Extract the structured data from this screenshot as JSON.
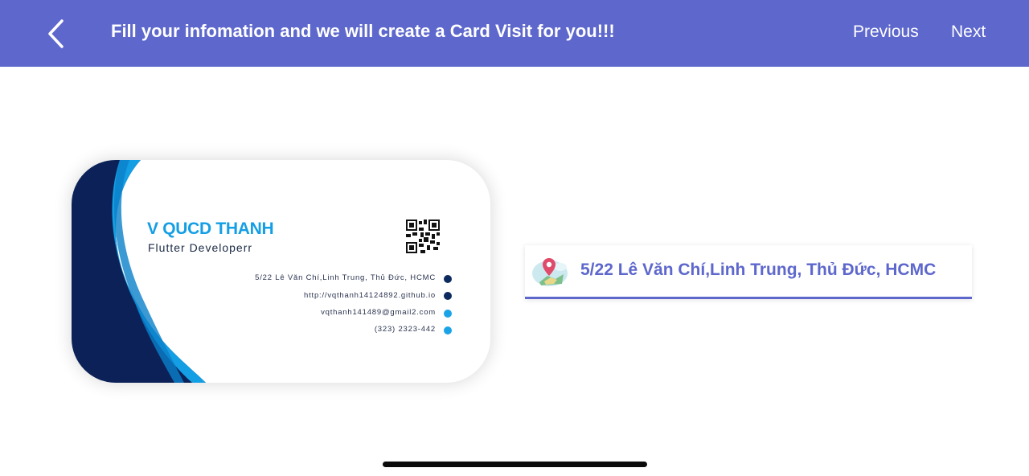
{
  "header": {
    "title": "Fill your infomation and we will create a Card Visit for you!!!",
    "previous_label": "Previous",
    "next_label": "Next"
  },
  "card": {
    "name": "V QUCD THANH",
    "role": "Flutter Developerr",
    "contacts": [
      {
        "text": "5/22 Lê Văn Chí,Linh Trung, Thủ Đức, HCMC",
        "icon": "location-icon",
        "color": "#0d2a5e"
      },
      {
        "text": "http://vqthanh14124892.github.io",
        "icon": "web-icon",
        "color": "#0d2a5e"
      },
      {
        "text": "vqthanh141489@gmail2.com",
        "icon": "mail-icon",
        "color": "#1aa3e6"
      },
      {
        "text": "(323) 2323-442",
        "icon": "phone-icon",
        "color": "#1aa3e6"
      }
    ]
  },
  "address_field": {
    "value": "5/22 Lê Văn Chí,Linh Trung, Thủ Đức, HCMC",
    "icon": "map-pin-icon"
  },
  "colors": {
    "accent": "#5d67cc",
    "card_navy": "#0b2157",
    "card_blue": "#149ee4"
  }
}
